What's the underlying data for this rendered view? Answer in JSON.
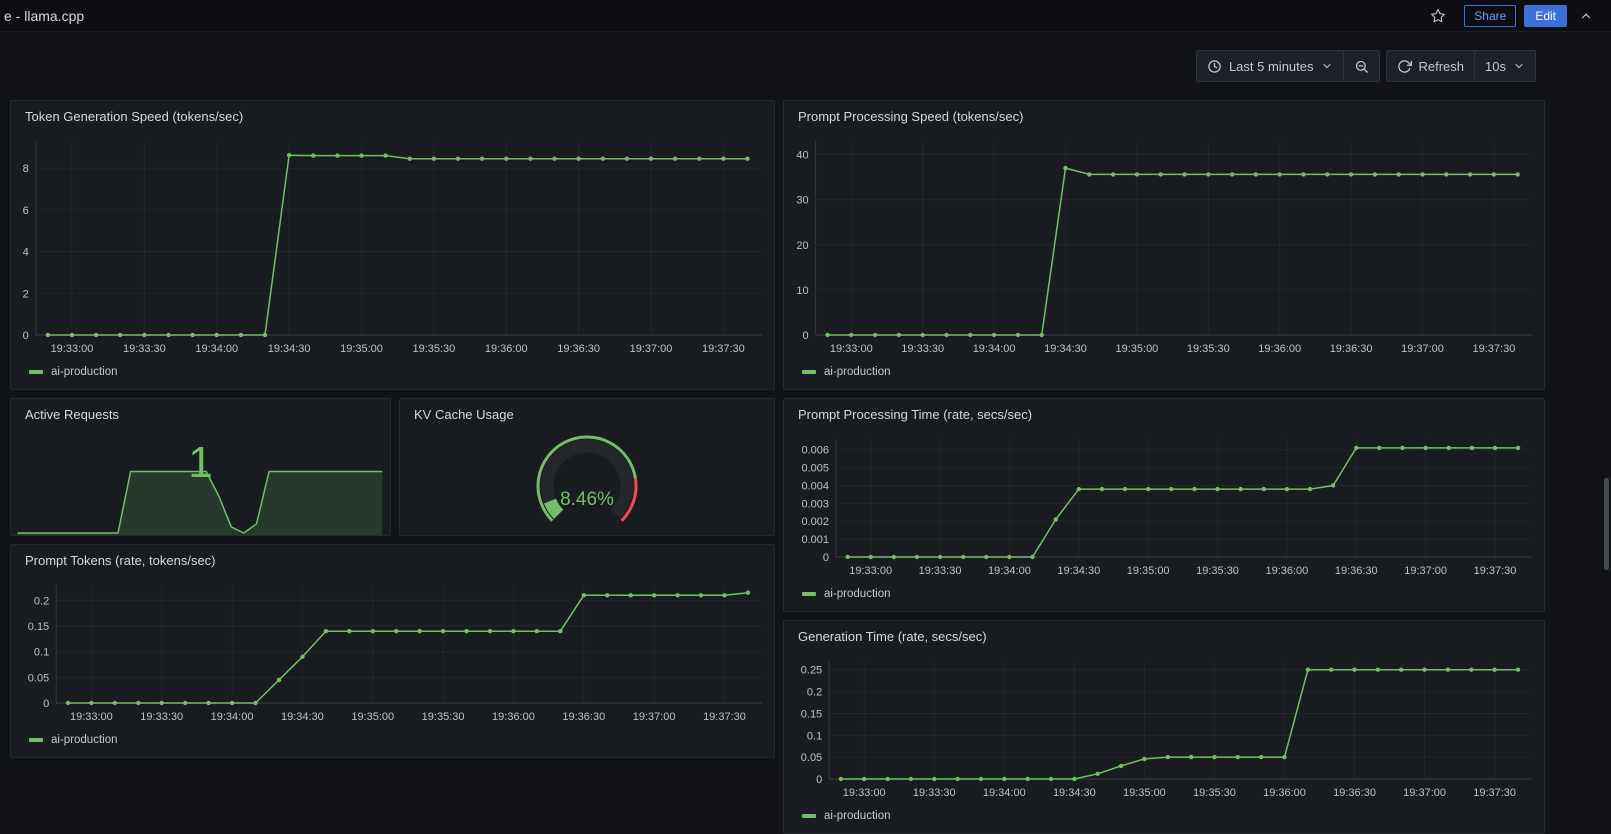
{
  "header": {
    "title": "e - llama.cpp",
    "share_label": "Share",
    "edit_label": "Edit"
  },
  "toolbar": {
    "time_range": "Last 5 minutes",
    "refresh_label": "Refresh",
    "interval": "10s"
  },
  "colors": {
    "accent_green": "#73bf69",
    "threshold_red": "#f2495c",
    "primary_blue": "#3d71d9"
  },
  "icons": {
    "favorite": "star-icon",
    "collapse": "chevron-up-icon",
    "time_range": "clock-icon",
    "zoom_out": "magnifier-minus-icon",
    "refresh": "refresh-icon",
    "dropdown": "chevron-down-icon"
  },
  "panels": [
    {
      "title": "Token Generation Speed (tokens/sec)",
      "legend": "ai-production",
      "chart_data": {
        "type": "line",
        "color": "#73bf69",
        "x": [
          "19:32:50",
          "19:33:00",
          "19:33:10",
          "19:33:20",
          "19:33:30",
          "19:33:40",
          "19:33:50",
          "19:34:00",
          "19:34:10",
          "19:34:20",
          "19:34:30",
          "19:34:40",
          "19:34:50",
          "19:35:00",
          "19:35:10",
          "19:35:20",
          "19:35:30",
          "19:35:40",
          "19:35:50",
          "19:36:00",
          "19:36:10",
          "19:36:20",
          "19:36:30",
          "19:36:40",
          "19:36:50",
          "19:37:00",
          "19:37:10",
          "19:37:20",
          "19:37:30",
          "19:37:40"
        ],
        "values": [
          0,
          0,
          0,
          0,
          0,
          0,
          0,
          0,
          0,
          0,
          8.62,
          8.6,
          8.6,
          8.6,
          8.6,
          8.45,
          8.45,
          8.45,
          8.45,
          8.45,
          8.45,
          8.45,
          8.45,
          8.45,
          8.45,
          8.45,
          8.45,
          8.45,
          8.45,
          8.45
        ],
        "yticks": [
          "0",
          "2",
          "4",
          "6",
          "8"
        ],
        "ylim": [
          0,
          9.3
        ],
        "xticks": [
          "19:33:00",
          "19:33:30",
          "19:34:00",
          "19:34:30",
          "19:35:00",
          "19:35:30",
          "19:36:00",
          "19:36:30",
          "19:37:00",
          "19:37:30"
        ],
        "xdomain": [
          "19:32:45",
          "19:37:46"
        ]
      }
    },
    {
      "title": "Prompt Processing Speed (tokens/sec)",
      "legend": "ai-production",
      "chart_data": {
        "type": "line",
        "color": "#73bf69",
        "x": [
          "19:32:50",
          "19:33:00",
          "19:33:10",
          "19:33:20",
          "19:33:30",
          "19:33:40",
          "19:33:50",
          "19:34:00",
          "19:34:10",
          "19:34:20",
          "19:34:30",
          "19:34:40",
          "19:34:50",
          "19:35:00",
          "19:35:10",
          "19:35:20",
          "19:35:30",
          "19:35:40",
          "19:35:50",
          "19:36:00",
          "19:36:10",
          "19:36:20",
          "19:36:30",
          "19:36:40",
          "19:36:50",
          "19:37:00",
          "19:37:10",
          "19:37:20",
          "19:37:30",
          "19:37:40"
        ],
        "values": [
          0,
          0,
          0,
          0,
          0,
          0,
          0,
          0,
          0,
          0,
          37,
          35.6,
          35.6,
          35.6,
          35.6,
          35.6,
          35.6,
          35.6,
          35.6,
          35.6,
          35.6,
          35.6,
          35.6,
          35.6,
          35.6,
          35.6,
          35.6,
          35.6,
          35.6,
          35.6
        ],
        "yticks": [
          "0",
          "10",
          "20",
          "30",
          "40"
        ],
        "ylim": [
          0,
          43
        ],
        "xticks": [
          "19:33:00",
          "19:33:30",
          "19:34:00",
          "19:34:30",
          "19:35:00",
          "19:35:30",
          "19:36:00",
          "19:36:30",
          "19:37:00",
          "19:37:30"
        ],
        "xdomain": [
          "19:32:45",
          "19:37:46"
        ]
      }
    },
    {
      "title": "Active Requests",
      "chart_data": {
        "type": "area",
        "color": "#73bf69",
        "value_display": "1",
        "x": [
          "19:32:50",
          "19:33:00",
          "19:33:10",
          "19:33:20",
          "19:33:30",
          "19:33:40",
          "19:33:50",
          "19:34:00",
          "19:34:10",
          "19:34:20",
          "19:34:30",
          "19:34:40",
          "19:34:50",
          "19:35:00",
          "19:35:10",
          "19:35:20",
          "19:35:30",
          "19:35:40",
          "19:35:50",
          "19:36:00",
          "19:36:10",
          "19:36:20",
          "19:36:30",
          "19:36:40",
          "19:36:50",
          "19:37:00",
          "19:37:10",
          "19:37:20",
          "19:37:30",
          "19:37:40"
        ],
        "values": [
          0,
          0,
          0,
          0,
          0,
          0,
          0,
          0,
          0,
          1,
          1,
          1,
          1,
          1,
          1,
          1,
          0.6,
          0.1,
          0,
          0.15,
          1,
          1,
          1,
          1,
          1,
          1,
          1,
          1,
          1,
          1
        ],
        "ylim": [
          0,
          1.15
        ],
        "xdomain": [
          "19:32:45",
          "19:37:46"
        ]
      }
    },
    {
      "title": "KV Cache Usage",
      "chart_data": {
        "type": "gauge",
        "value": 8.46,
        "display": "8.46%",
        "min": 0,
        "max": 100,
        "threshold": 80,
        "color": "#73bf69",
        "threshold_color": "#f2495c"
      }
    },
    {
      "title": "Prompt Processing Time (rate, secs/sec)",
      "legend": "ai-production",
      "chart_data": {
        "type": "line",
        "color": "#73bf69",
        "x": [
          "19:32:50",
          "19:33:00",
          "19:33:10",
          "19:33:20",
          "19:33:30",
          "19:33:40",
          "19:33:50",
          "19:34:00",
          "19:34:10",
          "19:34:20",
          "19:34:30",
          "19:34:40",
          "19:34:50",
          "19:35:00",
          "19:35:10",
          "19:35:20",
          "19:35:30",
          "19:35:40",
          "19:35:50",
          "19:36:00",
          "19:36:10",
          "19:36:20",
          "19:36:30",
          "19:36:40",
          "19:36:50",
          "19:37:00",
          "19:37:10",
          "19:37:20",
          "19:37:30",
          "19:37:40"
        ],
        "values": [
          0,
          0,
          0,
          0,
          0,
          0,
          0,
          0,
          0,
          0.0021,
          0.0038,
          0.0038,
          0.0038,
          0.0038,
          0.0038,
          0.0038,
          0.0038,
          0.0038,
          0.0038,
          0.0038,
          0.0038,
          0.004,
          0.0061,
          0.0061,
          0.0061,
          0.0061,
          0.0061,
          0.0061,
          0.0061,
          0.0061
        ],
        "yticks": [
          "0",
          "0.001",
          "0.002",
          "0.003",
          "0.004",
          "0.005",
          "0.006"
        ],
        "ylim": [
          0,
          0.0066
        ],
        "xticks": [
          "19:33:00",
          "19:33:30",
          "19:34:00",
          "19:34:30",
          "19:35:00",
          "19:35:30",
          "19:36:00",
          "19:36:30",
          "19:37:00",
          "19:37:30"
        ],
        "xdomain": [
          "19:32:45",
          "19:37:46"
        ]
      }
    },
    {
      "title": "Prompt Tokens (rate, tokens/sec)",
      "legend": "ai-production",
      "chart_data": {
        "type": "line",
        "color": "#73bf69",
        "x": [
          "19:32:50",
          "19:33:00",
          "19:33:10",
          "19:33:20",
          "19:33:30",
          "19:33:40",
          "19:33:50",
          "19:34:00",
          "19:34:10",
          "19:34:20",
          "19:34:30",
          "19:34:40",
          "19:34:50",
          "19:35:00",
          "19:35:10",
          "19:35:20",
          "19:35:30",
          "19:35:40",
          "19:35:50",
          "19:36:00",
          "19:36:10",
          "19:36:20",
          "19:36:30",
          "19:36:40",
          "19:36:50",
          "19:37:00",
          "19:37:10",
          "19:37:20",
          "19:37:30",
          "19:37:40"
        ],
        "values": [
          0,
          0,
          0,
          0,
          0,
          0,
          0,
          0,
          0,
          0.045,
          0.09,
          0.14,
          0.14,
          0.14,
          0.14,
          0.14,
          0.14,
          0.14,
          0.14,
          0.14,
          0.14,
          0.14,
          0.21,
          0.21,
          0.21,
          0.21,
          0.21,
          0.21,
          0.21,
          0.215
        ],
        "yticks": [
          "0",
          "0.05",
          "0.1",
          "0.15",
          "0.2"
        ],
        "ylim": [
          0,
          0.23
        ],
        "xticks": [
          "19:33:00",
          "19:33:30",
          "19:34:00",
          "19:34:30",
          "19:35:00",
          "19:35:30",
          "19:36:00",
          "19:36:30",
          "19:37:00",
          "19:37:30"
        ],
        "xdomain": [
          "19:32:45",
          "19:37:46"
        ]
      }
    },
    {
      "title": "Generation Time (rate, secs/sec)",
      "legend": "ai-production",
      "chart_data": {
        "type": "line",
        "color": "#73bf69",
        "x": [
          "19:32:50",
          "19:33:00",
          "19:33:10",
          "19:33:20",
          "19:33:30",
          "19:33:40",
          "19:33:50",
          "19:34:00",
          "19:34:10",
          "19:34:20",
          "19:34:30",
          "19:34:40",
          "19:34:50",
          "19:35:00",
          "19:35:10",
          "19:35:20",
          "19:35:30",
          "19:35:40",
          "19:35:50",
          "19:36:00",
          "19:36:10",
          "19:36:20",
          "19:36:30",
          "19:36:40",
          "19:36:50",
          "19:37:00",
          "19:37:10",
          "19:37:20",
          "19:37:30",
          "19:37:40"
        ],
        "values": [
          0,
          0,
          0,
          0,
          0,
          0,
          0,
          0,
          0,
          0,
          0,
          0.012,
          0.03,
          0.046,
          0.05,
          0.05,
          0.05,
          0.05,
          0.05,
          0.05,
          0.25,
          0.25,
          0.25,
          0.25,
          0.25,
          0.25,
          0.25,
          0.25,
          0.25,
          0.25
        ],
        "yticks": [
          "0",
          "0.05",
          "0.1",
          "0.15",
          "0.2",
          "0.25"
        ],
        "ylim": [
          0,
          0.27
        ],
        "xticks": [
          "19:33:00",
          "19:33:30",
          "19:34:00",
          "19:34:30",
          "19:35:00",
          "19:35:30",
          "19:36:00",
          "19:36:30",
          "19:37:00",
          "19:37:30"
        ],
        "xdomain": [
          "19:32:45",
          "19:37:46"
        ]
      }
    }
  ]
}
